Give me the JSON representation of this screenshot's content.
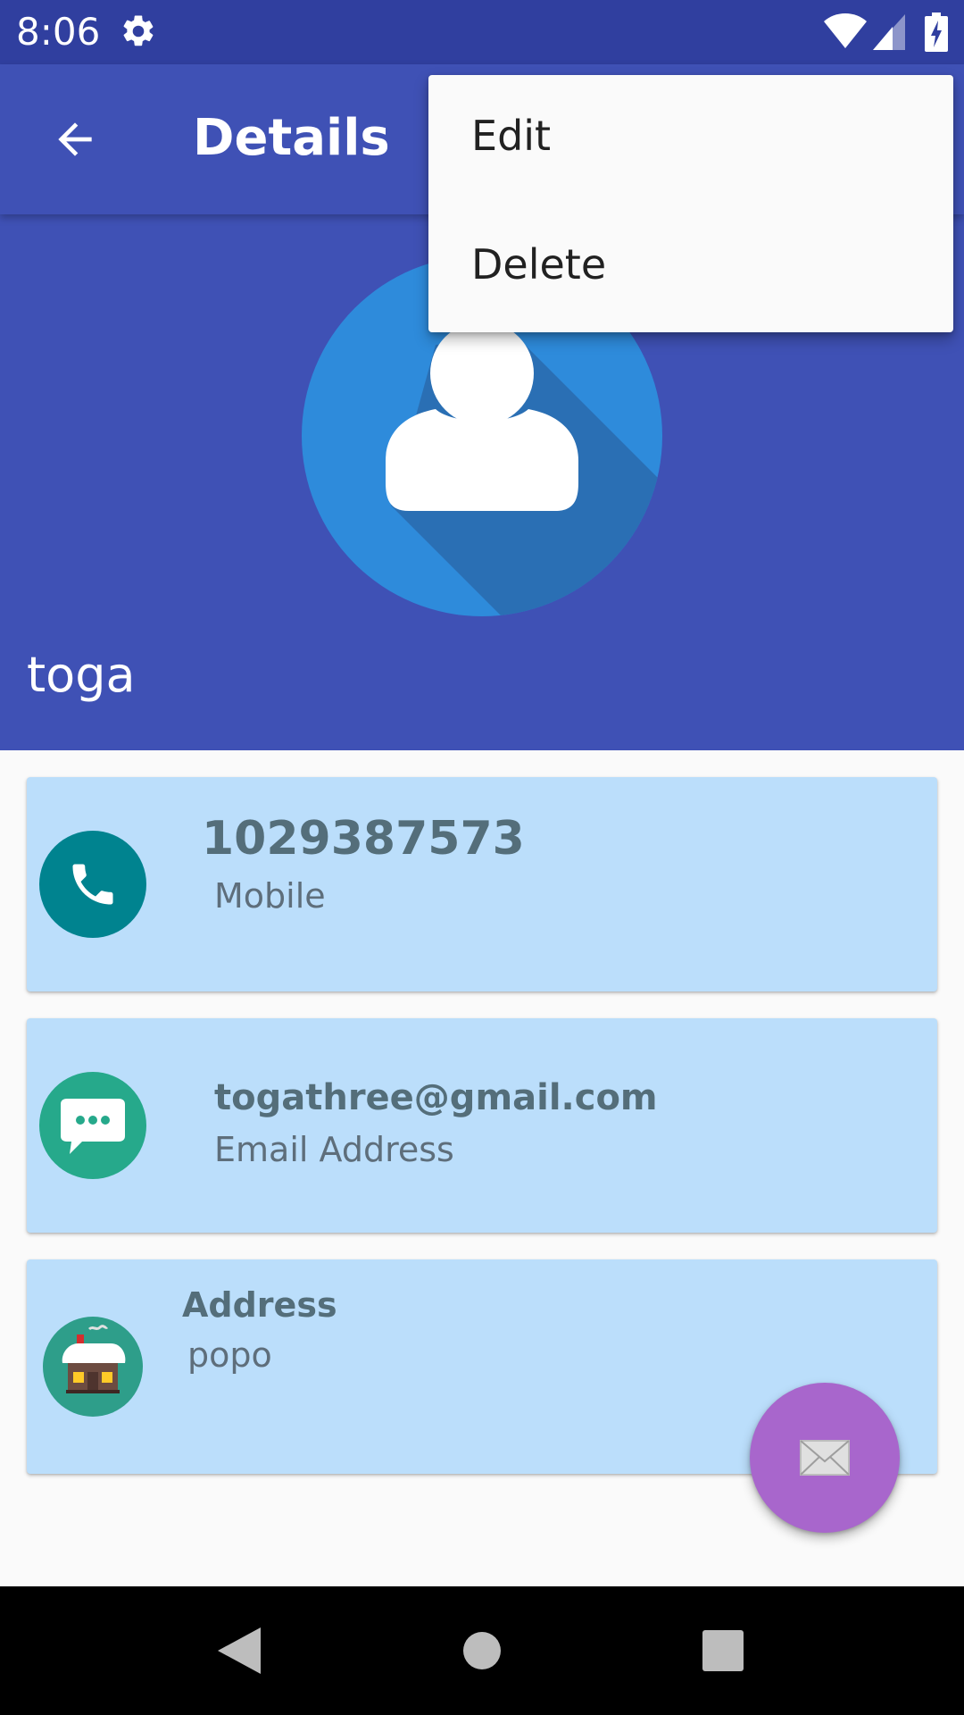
{
  "status_bar": {
    "time": "8:06",
    "icons": [
      "settings-gear-icon",
      "wifi-icon",
      "cell-signal-icon",
      "battery-charging-icon"
    ]
  },
  "toolbar": {
    "back_icon": "arrow-back-icon",
    "title": "Details"
  },
  "overflow_menu": {
    "items": [
      {
        "label": "Edit"
      },
      {
        "label": "Delete"
      }
    ]
  },
  "contact": {
    "avatar_icon": "person-avatar-icon",
    "name": "toga"
  },
  "cards": [
    {
      "icon": "phone-icon",
      "value": "1029387573",
      "label": "Mobile"
    },
    {
      "icon": "message-icon",
      "value": "togathree@gmail.com",
      "label": "Email Address"
    },
    {
      "icon": "house-icon",
      "value": "Address",
      "label": "popo"
    }
  ],
  "fab": {
    "icon": "mail-envelope-icon"
  },
  "nav_bar": {
    "icons": [
      "nav-back-icon",
      "nav-home-icon",
      "nav-recents-icon"
    ]
  },
  "colors": {
    "status_bar": "#303F9F",
    "primary": "#3F51B5",
    "card_background": "#BBDEFB",
    "card_text": "#546E7A",
    "fab": "#A866CC",
    "phone_icon_bg": "#00838F",
    "message_icon_bg": "#26A98B",
    "house_icon_bg": "#2E9E8A",
    "avatar_circle": "#2E8BDB"
  }
}
